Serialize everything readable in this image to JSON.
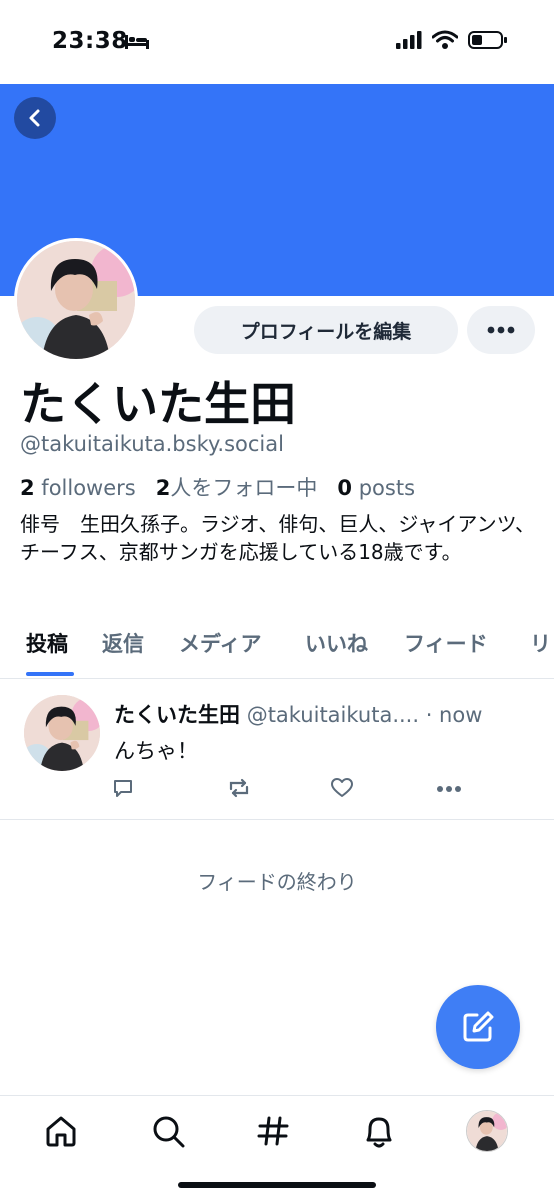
{
  "status_bar": {
    "time": "23:38"
  },
  "profile": {
    "edit_label": "プロフィールを編集",
    "display_name": "たくいた生田",
    "handle": "@takuitaikuta.bsky.social",
    "followers_count": "2",
    "followers_label": " followers",
    "following_count": "2",
    "following_label": "人をフォロー中",
    "posts_count": "0",
    "posts_label": " posts",
    "bio": "俳号　生田久孫子。ラジオ、俳句、巨人、ジャイアンツ、チーフス、京都サンガを応援している18歳です。"
  },
  "tabs": [
    "投稿",
    "返信",
    "メディア",
    "いいね",
    "フィード",
    "リ"
  ],
  "post": {
    "author": "たくいた生田",
    "handle": "@takuitaikuta....",
    "time": " · now",
    "text": "んちゃ！"
  },
  "feed_end": "フィードの終わり",
  "colors": {
    "accent": "#3474f8",
    "muted": "#5b6b7b"
  }
}
